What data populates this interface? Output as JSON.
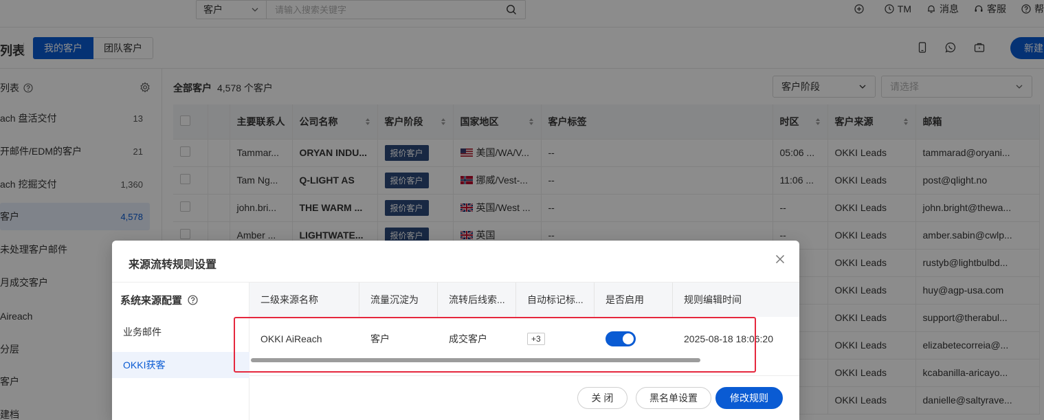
{
  "topbar": {
    "search_type": "客户",
    "search_placeholder": "请输入搜索关键字",
    "items": [
      {
        "label": "TM"
      },
      {
        "label": "消息"
      },
      {
        "label": "客服"
      },
      {
        "label": "帮"
      }
    ]
  },
  "header": {
    "title": "列表",
    "tabs": [
      {
        "label": "我的客户",
        "active": true
      },
      {
        "label": "团队客户",
        "active": false
      }
    ],
    "new_button": "新建"
  },
  "sidebar": {
    "heading": "列表",
    "items": [
      {
        "label": "ach 盘活交付",
        "count": "13"
      },
      {
        "label": "开邮件/EDM的客户",
        "count": "21"
      },
      {
        "label": "ach 挖掘交付",
        "count": "1,360"
      },
      {
        "label": "客户",
        "count": "4,578",
        "active": true
      },
      {
        "label": "未处理客户邮件",
        "count": ""
      },
      {
        "label": "月成交客户",
        "count": ""
      },
      {
        "label": "Aireach",
        "count": ""
      },
      {
        "label": "分层",
        "count": ""
      },
      {
        "label": "客户",
        "count": ""
      },
      {
        "label": "建档",
        "count": ""
      }
    ]
  },
  "main": {
    "summary_title": "全部客户",
    "summary_count": "4,578 个客户",
    "filter_stage": "客户阶段",
    "filter_placeholder": "请选择",
    "columns": [
      "主要联系人",
      "公司名称",
      "客户阶段",
      "国家地区",
      "客户标签",
      "时区",
      "客户来源",
      "邮箱"
    ],
    "rows": [
      {
        "contact": "Tammar...",
        "company": "ORYAN INDU...",
        "stage": "报价客户",
        "country": "美国/WA/V...",
        "flag": "us",
        "tag": "--",
        "tz": "05:06 ...",
        "source": "OKKI Leads",
        "email": "tammarad@oryani..."
      },
      {
        "contact": "Tam Ng...",
        "company": "Q-LIGHT AS",
        "stage": "报价客户",
        "country": "挪威/Vest-...",
        "flag": "no",
        "tag": "--",
        "tz": "11:06 ...",
        "source": "OKKI Leads",
        "email": "post@qlight.no"
      },
      {
        "contact": "john.bri...",
        "company": "THE WARM ...",
        "stage": "报价客户",
        "country": "英国/West ...",
        "flag": "gb",
        "tag": "--",
        "tz": "--",
        "source": "OKKI Leads",
        "email": "john.bright@thewa..."
      },
      {
        "contact": "Amber ...",
        "company": "LIGHTWATE...",
        "stage": "报价客户",
        "country": "英国",
        "flag": "gb",
        "tag": "--",
        "tz": "--",
        "source": "OKKI Leads",
        "email": "amber.sabin@cwlp..."
      },
      {
        "contact": "",
        "company": "",
        "stage": "",
        "country": "",
        "flag": "",
        "tag": "",
        "tz": "",
        "source": "OKKI Leads",
        "email": "rustyb@lightbulbd..."
      },
      {
        "contact": "",
        "company": "",
        "stage": "",
        "country": "",
        "flag": "",
        "tag": "",
        "tz": "",
        "source": "OKKI Leads",
        "email": "huy@agp-usa.com"
      },
      {
        "contact": "",
        "company": "",
        "stage": "",
        "country": "",
        "flag": "",
        "tag": "",
        "tz": "",
        "source": "OKKI Leads",
        "email": "support@therabul..."
      },
      {
        "contact": "",
        "company": "",
        "stage": "",
        "country": "",
        "flag": "",
        "tag": "",
        "tz": "",
        "source": "OKKI Leads",
        "email": "elizabetecorreia@..."
      },
      {
        "contact": "",
        "company": "",
        "stage": "",
        "country": "",
        "flag": "",
        "tag": "",
        "tz": "",
        "source": "OKKI Leads",
        "email": "kcabanilla-aricayo..."
      },
      {
        "contact": "",
        "company": "",
        "stage": "",
        "country": "",
        "flag": "",
        "tag": "",
        "tz": "",
        "source": "OKKI Leads",
        "email": "danielle@saltyrave..."
      }
    ]
  },
  "modal": {
    "title": "来源流转规则设置",
    "side_heading": "系统来源配置",
    "side_items": [
      {
        "label": "业务邮件",
        "active": false
      },
      {
        "label": "OKKI获客",
        "active": true
      }
    ],
    "columns": [
      "二级来源名称",
      "流量沉淀为",
      "流转后线索...",
      "自动标记标...",
      "是否启用",
      "规则编辑时间"
    ],
    "row": {
      "name": "OKKI AiReach",
      "settle": "客户",
      "after": "成交客户",
      "tags": "+3",
      "enabled": true,
      "edited": "2025-08-18 18:06:20"
    },
    "buttons": {
      "close": "关 闭",
      "blacklist": "黑名单设置",
      "edit": "修改规则"
    }
  },
  "colors": {
    "primary": "#0a5bd3",
    "badge": "#2c4a7a",
    "highlight": "#e5273d"
  }
}
